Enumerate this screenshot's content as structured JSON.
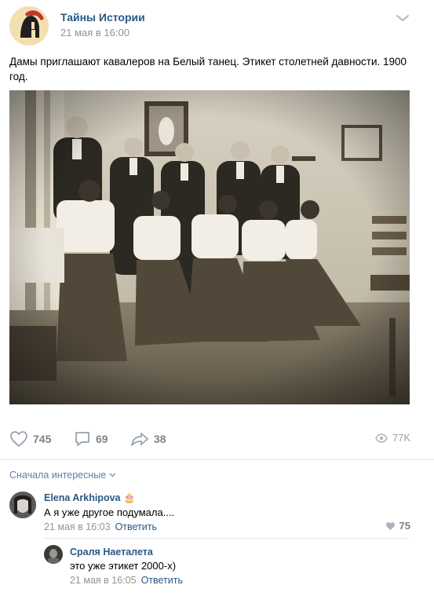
{
  "post": {
    "group_name": "Тайны Истории",
    "date": "21 мая в 16:00",
    "text": "Дамы приглашают кавалеров на Белый танец. Этикет столетней давности. 1900 год."
  },
  "actions": {
    "likes": "745",
    "comments": "69",
    "shares": "38",
    "views": "77K"
  },
  "comments_sort": "Сначала интересные",
  "comments": [
    {
      "author": "Elena Arkhipova",
      "text": "А я уже другое подумала....",
      "date": "21 мая в 16:03",
      "reply_label": "Ответить",
      "likes": "75"
    },
    {
      "author": "Сраля Наеталета",
      "text": "это уже этикет 2000-х)",
      "date": "21 мая в 16:05",
      "reply_label": "Ответить"
    }
  ],
  "colors": {
    "link": "#2a5885",
    "meta": "#939393",
    "action": "#828282"
  }
}
